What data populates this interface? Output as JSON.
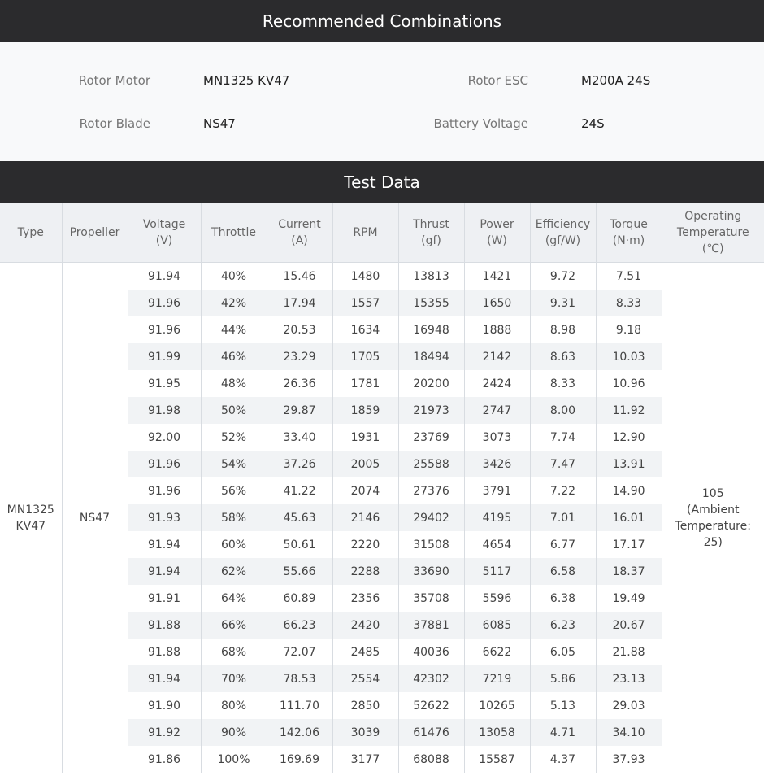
{
  "sections": {
    "combinations_title": "Recommended Combinations",
    "test_title": "Test Data"
  },
  "combinations": {
    "rotor_motor_label": "Rotor Motor",
    "rotor_motor_value": "MN1325 KV47",
    "rotor_esc_label": "Rotor ESC",
    "rotor_esc_value": "M200A 24S",
    "rotor_blade_label": "Rotor Blade",
    "rotor_blade_value": "NS47",
    "battery_voltage_label": "Battery Voltage",
    "battery_voltage_value": "24S"
  },
  "table": {
    "headers": [
      [
        "Type"
      ],
      [
        "Propeller"
      ],
      [
        "Voltage",
        "(V)"
      ],
      [
        "Throttle"
      ],
      [
        "Current",
        "(A)"
      ],
      [
        "RPM"
      ],
      [
        "Thrust",
        "(gf)"
      ],
      [
        "Power",
        "(W)"
      ],
      [
        "Efficiency",
        "(gf/W)"
      ],
      [
        "Torque",
        "(N·m)"
      ],
      [
        "Operating",
        "Temperature",
        "(℃)"
      ]
    ],
    "type_lines": [
      "MN1325",
      "KV47"
    ],
    "propeller": "NS47",
    "temperature_lines": [
      "105",
      "(Ambient",
      "Temperature:",
      "25)"
    ],
    "rows": [
      [
        "91.94",
        "40%",
        "15.46",
        "1480",
        "13813",
        "1421",
        "9.72",
        "7.51"
      ],
      [
        "91.96",
        "42%",
        "17.94",
        "1557",
        "15355",
        "1650",
        "9.31",
        "8.33"
      ],
      [
        "91.96",
        "44%",
        "20.53",
        "1634",
        "16948",
        "1888",
        "8.98",
        "9.18"
      ],
      [
        "91.99",
        "46%",
        "23.29",
        "1705",
        "18494",
        "2142",
        "8.63",
        "10.03"
      ],
      [
        "91.95",
        "48%",
        "26.36",
        "1781",
        "20200",
        "2424",
        "8.33",
        "10.96"
      ],
      [
        "91.98",
        "50%",
        "29.87",
        "1859",
        "21973",
        "2747",
        "8.00",
        "11.92"
      ],
      [
        "92.00",
        "52%",
        "33.40",
        "1931",
        "23769",
        "3073",
        "7.74",
        "12.90"
      ],
      [
        "91.96",
        "54%",
        "37.26",
        "2005",
        "25588",
        "3426",
        "7.47",
        "13.91"
      ],
      [
        "91.96",
        "56%",
        "41.22",
        "2074",
        "27376",
        "3791",
        "7.22",
        "14.90"
      ],
      [
        "91.93",
        "58%",
        "45.63",
        "2146",
        "29402",
        "4195",
        "7.01",
        "16.01"
      ],
      [
        "91.94",
        "60%",
        "50.61",
        "2220",
        "31508",
        "4654",
        "6.77",
        "17.17"
      ],
      [
        "91.94",
        "62%",
        "55.66",
        "2288",
        "33690",
        "5117",
        "6.58",
        "18.37"
      ],
      [
        "91.91",
        "64%",
        "60.89",
        "2356",
        "35708",
        "5596",
        "6.38",
        "19.49"
      ],
      [
        "91.88",
        "66%",
        "66.23",
        "2420",
        "37881",
        "6085",
        "6.23",
        "20.67"
      ],
      [
        "91.88",
        "68%",
        "72.07",
        "2485",
        "40036",
        "6622",
        "6.05",
        "21.88"
      ],
      [
        "91.94",
        "70%",
        "78.53",
        "2554",
        "42302",
        "7219",
        "5.86",
        "23.13"
      ],
      [
        "91.90",
        "80%",
        "111.70",
        "2850",
        "52622",
        "10265",
        "5.13",
        "29.03"
      ],
      [
        "91.92",
        "90%",
        "142.06",
        "3039",
        "61476",
        "13058",
        "4.71",
        "34.10"
      ],
      [
        "91.86",
        "100%",
        "169.69",
        "3177",
        "68088",
        "15587",
        "4.37",
        "37.93"
      ]
    ]
  }
}
